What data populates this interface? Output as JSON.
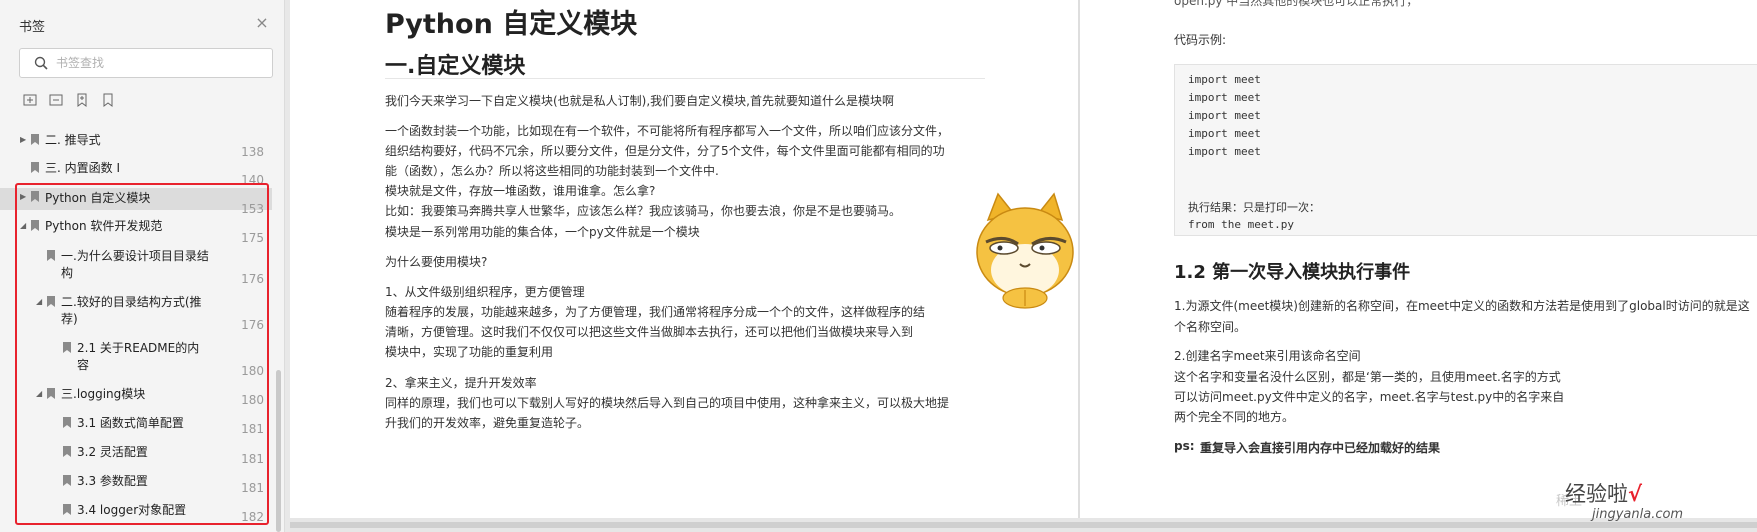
{
  "sidebar": {
    "title": "书签",
    "search_placeholder": "书签查找",
    "items": [
      {
        "label": "二. 推导式",
        "page": "138"
      },
      {
        "label": "三. 内置函数 I",
        "page": "140"
      },
      {
        "label": "Python 自定义模块",
        "page": "153"
      },
      {
        "label": "Python 软件开发规范",
        "page": "175"
      },
      {
        "label": "一.为什么要设计项目目录结",
        "label2": "构",
        "page": "176"
      },
      {
        "label": "二.较好的目录结构方式(推",
        "label2": "荐)",
        "page": "176"
      },
      {
        "label": "2.1 关于README的内",
        "label2": "容",
        "page": "180"
      },
      {
        "label": "三.logging模块",
        "page": "180"
      },
      {
        "label": "3.1 函数式简单配置",
        "page": "181"
      },
      {
        "label": "3.2 灵活配置",
        "page": "181"
      },
      {
        "label": "3.3 参数配置",
        "page": "181"
      },
      {
        "label": "3.4 logger对象配置",
        "page": "182"
      }
    ]
  },
  "left_page": {
    "title": "Python 自定义模块",
    "h1": "一.自定义模块",
    "paragraphs": [
      "我们今天来学习一下自定义模块(也就是私人订制),我们要自定义模块,首先就要知道什么是模块啊",
      "一个函数封装一个功能，比如现在有一个软件，不可能将所有程序都写入一个文件，所以咱们应该分文件，",
      "组织结构要好，代码不冗余，所以要分文件，但是分文件，分了5个文件，每个文件里面可能都有相同的功",
      "能（函数），怎么办？所以将这些相同的功能封装到一个文件中.",
      "模块就是文件，存放一堆函数，谁用谁拿。怎么拿?",
      "比如：我要策马奔腾共享人世繁华，应该怎么样？我应该骑马，你也要去浪，你是不是也要骑马。",
      "模块是一系列常用功能的集合体，一个py文件就是一个模块",
      "为什么要使用模块?",
      "1、从文件级别组织程序，更方便管理",
      "随着程序的发展，功能越来越多，为了方便管理，我们通常将程序分成一个个的文件，这样做程序的结",
      "清晰，方便管理。这时我们不仅仅可以把这些文件当做脚本去执行，还可以把他们当做模块来导入到",
      "模块中，实现了功能的重复利用",
      "2、拿来主义，提升开发效率",
      "同样的原理，我们也可以下载别人写好的模块然后导入到自己的项目中使用，这种拿来主义，可以极大地提",
      "升我们的开发效率，避免重复造轮子。"
    ]
  },
  "right_page": {
    "top_partial": "open.py 中当然其他的模块也可以正常执行，",
    "code_label": "代码示例:",
    "code_lines": [
      "import meet",
      "import meet",
      "import meet",
      "import meet",
      "import meet"
    ],
    "result_label": "执行结果：只是打印一次：",
    "result_code": "from the meet.py",
    "h2": "1.2 第一次导入模块执行事件",
    "paragraphs": [
      "1.为源文件(meet模块)创建新的名称空间，在meet中定义的函数和方法若是使用到了global时访问的就是这",
      "个名称空间。",
      "2.创建名字meet来引用该命名空间",
      "   这个名字和变量名没什么区别，都是‘第一类的，且使用meet.名字的方式",
      "   可以访问meet.py文件中定义的名字，meet.名字与test.py中的名字来自",
      "   两个完全不同的地方。"
    ],
    "ps_label": "ps:",
    "ps_text": "重复导入会直接引用内存中已经加载好的结果"
  },
  "watermark": {
    "brand": "经验啦",
    "check": "√",
    "site": "jingyanla.com",
    "faint": "稀土"
  },
  "colors": {
    "highlight_box": "#e8222d",
    "selected_row": "#dcdcdc"
  }
}
